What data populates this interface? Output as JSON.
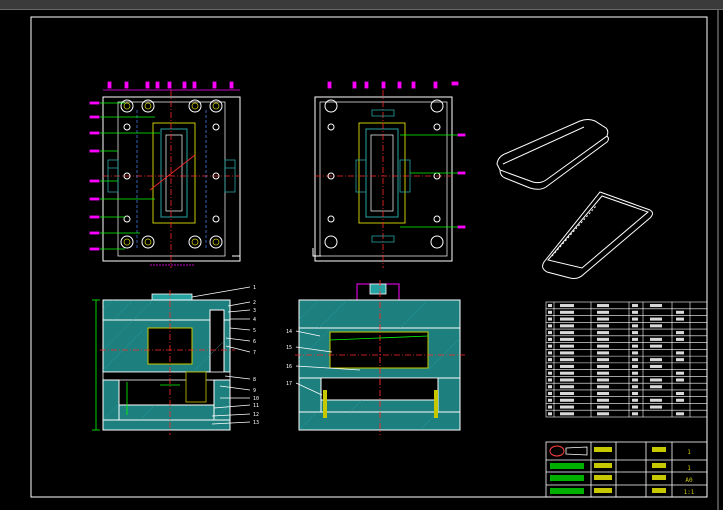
{
  "window": {
    "title": "",
    "background": "#000000"
  },
  "colors": {
    "frame": "#ffffff",
    "outline": "#ffffff",
    "hatch": "#27a2a2",
    "centerline": "#ff2a2a",
    "dimension": "#ff00ff",
    "leader": "#00ff00",
    "hidden": "#4f8cff",
    "steel": "#2a8c8c",
    "insert": "#c8c800"
  },
  "drawing": {
    "views": [
      {
        "id": "moving-half-plan",
        "kind": "plan"
      },
      {
        "id": "fixed-half-plan",
        "kind": "plan"
      },
      {
        "id": "section-left",
        "kind": "section"
      },
      {
        "id": "section-right",
        "kind": "section"
      },
      {
        "id": "part-iso-top",
        "kind": "isometric"
      },
      {
        "id": "part-iso-bottom",
        "kind": "isometric"
      }
    ],
    "right_balloons": [
      "1",
      "2",
      "3",
      "4",
      "5",
      "6",
      "7",
      "8",
      "9",
      "10",
      "11",
      "12",
      "13"
    ],
    "left_balloons": [
      "14",
      "15",
      "16",
      "17"
    ]
  },
  "parts_table": {
    "row_count": 17
  },
  "title_block": {
    "values": [
      "1",
      "1",
      "A0",
      "1:1"
    ]
  }
}
